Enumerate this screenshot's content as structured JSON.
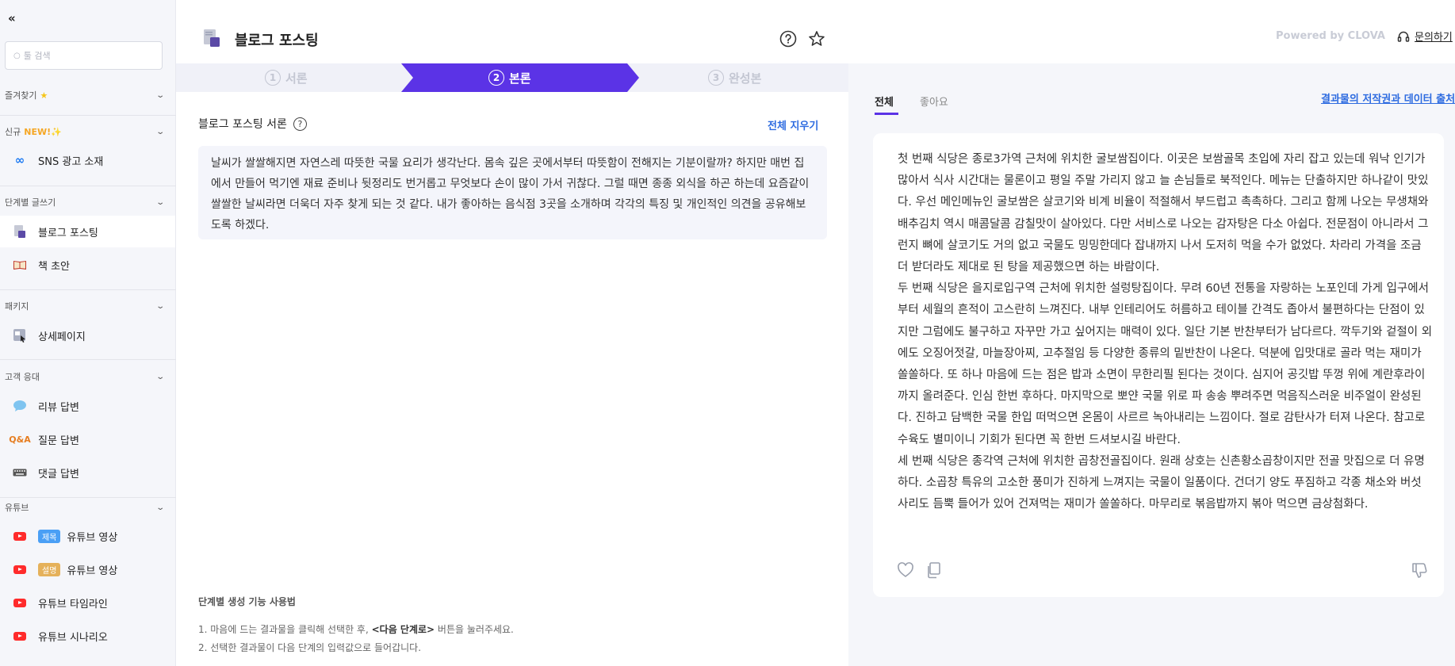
{
  "sidebar": {
    "search_placeholder": "툴 검색",
    "sections": {
      "favorites": "즐겨찾기",
      "new": "신규",
      "new_badge": "NEW!",
      "steps": "단계별 글쓰기",
      "package": "패키지",
      "customer": "고객 응대",
      "youtube": "유튜브"
    },
    "items": {
      "sns_ad": "SNS 광고 소재",
      "blog_post": "블로그 포스팅",
      "book_draft": "책 초안",
      "detail_page": "상세페이지",
      "review_reply": "리뷰 답변",
      "qa_reply": "질문 답변",
      "comment_reply": "댓글 답변",
      "yt_video_title": "유튜브 영상",
      "yt_video_desc": "유튜브 영상",
      "yt_timeline": "유튜브 타임라인",
      "yt_scenario": "유튜브 시나리오"
    },
    "tags": {
      "title": "제목",
      "desc": "설명"
    },
    "qa_icon_text": "Q&A"
  },
  "header": {
    "title": "블로그 포스팅",
    "powered_by": "Powered by CLOVA",
    "contact": "문의하기"
  },
  "steps": [
    {
      "num": "1",
      "label": "서론"
    },
    {
      "num": "2",
      "label": "본론"
    },
    {
      "num": "3",
      "label": "완성본"
    }
  ],
  "left_panel": {
    "title": "블로그 포스팅 서론",
    "clear_all": "전체 지우기",
    "intro_text": "날씨가 쌀쌀해지면 자연스레 따뜻한 국물 요리가 생각난다. 몸속 깊은 곳에서부터 따뜻함이 전해지는 기분이랄까? 하지만 매번 집에서 만들어 먹기엔 재료 준비나 뒷정리도 번거롭고 무엇보다 손이 많이 가서 귀찮다. 그럴 때면 종종 외식을 하곤 하는데 요즘같이 쌀쌀한 날씨라면 더욱더 자주 찾게 되는 것 같다. 내가 좋아하는 음식점 3곳을 소개하며 각각의 특징 및 개인적인 의견을 공유해보도록 하겠다.",
    "howto_title": "단계별 생성 기능 사용법",
    "howto_1_pre": "1. 마음에 드는 결과물을 클릭해 선택한 후, ",
    "howto_1_bold": "<다음 단계로>",
    "howto_1_post": " 버튼을 눌러주세요.",
    "howto_2": "2. 선택한 결과물이 다음 단계의 입력값으로 들어갑니다."
  },
  "right_panel": {
    "tabs": [
      "전체",
      "좋아요"
    ],
    "copyright_link": "결과물의 저작권과 데이터 출처",
    "result_paragraphs": [
      "첫 번째 식당은 종로3가역 근처에 위치한 굴보쌈집이다. 이곳은 보쌈골목 초입에 자리 잡고 있는데 워낙 인기가 많아서 식사 시간대는 물론이고 평일 주말 가리지 않고 늘 손님들로 북적인다. 메뉴는 단출하지만 하나같이 맛있다. 우선 메인메뉴인 굴보쌈은 살코기와 비계 비율이 적절해서 부드럽고 촉촉하다. 그리고 함께 나오는 무생채와 배추김치 역시 매콤달콤 감칠맛이 살아있다. 다만 서비스로 나오는 감자탕은 다소 아쉽다. 전문점이 아니라서 그런지 뼈에 살코기도 거의 없고 국물도 밍밍한데다 잡내까지 나서 도저히 먹을 수가 없었다. 차라리 가격을 조금 더 받더라도 제대로 된 탕을 제공했으면 하는 바람이다.",
      "두 번째 식당은 을지로입구역 근처에 위치한 설렁탕집이다. 무려 60년 전통을 자랑하는 노포인데 가게 입구에서부터 세월의 흔적이 고스란히 느껴진다. 내부 인테리어도 허름하고 테이블 간격도 좁아서 불편하다는 단점이 있지만 그럼에도 불구하고 자꾸만 가고 싶어지는 매력이 있다. 일단 기본 반찬부터가 남다르다. 깍두기와 겉절이 외에도 오징어젓갈, 마늘장아찌, 고추절임 등 다양한 종류의 밑반찬이 나온다. 덕분에 입맛대로 골라 먹는 재미가 쏠쏠하다. 또 하나 마음에 드는 점은 밥과 소면이 무한리필 된다는 것이다. 심지어 공깃밥 뚜껑 위에 계란후라이까지 올려준다. 인심 한번 후하다. 마지막으로 뽀얀 국물 위로 파 송송 뿌려주면 먹음직스러운 비주얼이 완성된다. 진하고 담백한 국물 한입 떠먹으면 온몸이 사르르 녹아내리는 느낌이다. 절로 감탄사가 터져 나온다. 참고로 수육도 별미이니 기회가 된다면 꼭 한번 드셔보시길 바란다.",
      "세 번째 식당은 종각역 근처에 위치한 곱창전골집이다. 원래 상호는 신촌황소곱창이지만 전골 맛집으로 더 유명하다. 소곱창 특유의 고소한 풍미가 진하게 느껴지는 국물이 일품이다. 건더기 양도 푸짐하고 각종 채소와 버섯 사리도 듬뿍 들어가 있어 건져먹는 재미가 쏠쏠하다. 마무리로 볶음밥까지 볶아 먹으면 금상첨화다."
    ]
  },
  "colors": {
    "accent": "#5b33e6",
    "link": "#2d6be0",
    "new": "#f5a623"
  }
}
